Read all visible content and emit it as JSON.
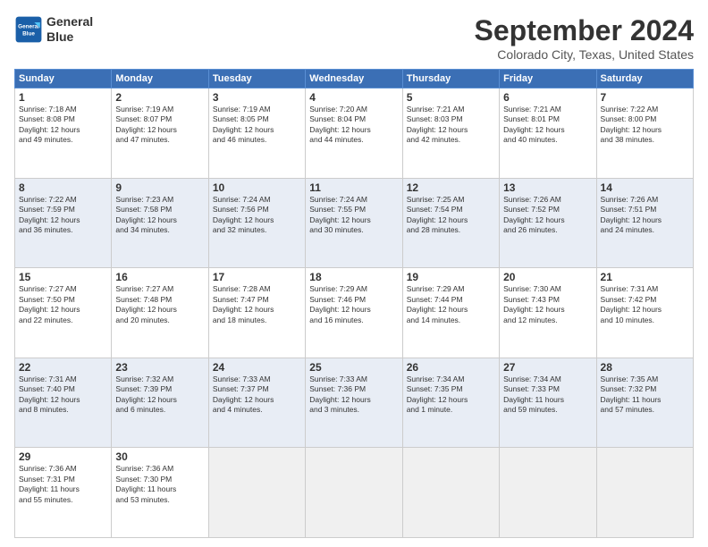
{
  "header": {
    "logo_line1": "General",
    "logo_line2": "Blue",
    "month": "September 2024",
    "location": "Colorado City, Texas, United States"
  },
  "days_of_week": [
    "Sunday",
    "Monday",
    "Tuesday",
    "Wednesday",
    "Thursday",
    "Friday",
    "Saturday"
  ],
  "weeks": [
    [
      {
        "day": "1",
        "lines": [
          "Sunrise: 7:18 AM",
          "Sunset: 8:08 PM",
          "Daylight: 12 hours",
          "and 49 minutes."
        ]
      },
      {
        "day": "2",
        "lines": [
          "Sunrise: 7:19 AM",
          "Sunset: 8:07 PM",
          "Daylight: 12 hours",
          "and 47 minutes."
        ]
      },
      {
        "day": "3",
        "lines": [
          "Sunrise: 7:19 AM",
          "Sunset: 8:05 PM",
          "Daylight: 12 hours",
          "and 46 minutes."
        ]
      },
      {
        "day": "4",
        "lines": [
          "Sunrise: 7:20 AM",
          "Sunset: 8:04 PM",
          "Daylight: 12 hours",
          "and 44 minutes."
        ]
      },
      {
        "day": "5",
        "lines": [
          "Sunrise: 7:21 AM",
          "Sunset: 8:03 PM",
          "Daylight: 12 hours",
          "and 42 minutes."
        ]
      },
      {
        "day": "6",
        "lines": [
          "Sunrise: 7:21 AM",
          "Sunset: 8:01 PM",
          "Daylight: 12 hours",
          "and 40 minutes."
        ]
      },
      {
        "day": "7",
        "lines": [
          "Sunrise: 7:22 AM",
          "Sunset: 8:00 PM",
          "Daylight: 12 hours",
          "and 38 minutes."
        ]
      }
    ],
    [
      {
        "day": "8",
        "lines": [
          "Sunrise: 7:22 AM",
          "Sunset: 7:59 PM",
          "Daylight: 12 hours",
          "and 36 minutes."
        ]
      },
      {
        "day": "9",
        "lines": [
          "Sunrise: 7:23 AM",
          "Sunset: 7:58 PM",
          "Daylight: 12 hours",
          "and 34 minutes."
        ]
      },
      {
        "day": "10",
        "lines": [
          "Sunrise: 7:24 AM",
          "Sunset: 7:56 PM",
          "Daylight: 12 hours",
          "and 32 minutes."
        ]
      },
      {
        "day": "11",
        "lines": [
          "Sunrise: 7:24 AM",
          "Sunset: 7:55 PM",
          "Daylight: 12 hours",
          "and 30 minutes."
        ]
      },
      {
        "day": "12",
        "lines": [
          "Sunrise: 7:25 AM",
          "Sunset: 7:54 PM",
          "Daylight: 12 hours",
          "and 28 minutes."
        ]
      },
      {
        "day": "13",
        "lines": [
          "Sunrise: 7:26 AM",
          "Sunset: 7:52 PM",
          "Daylight: 12 hours",
          "and 26 minutes."
        ]
      },
      {
        "day": "14",
        "lines": [
          "Sunrise: 7:26 AM",
          "Sunset: 7:51 PM",
          "Daylight: 12 hours",
          "and 24 minutes."
        ]
      }
    ],
    [
      {
        "day": "15",
        "lines": [
          "Sunrise: 7:27 AM",
          "Sunset: 7:50 PM",
          "Daylight: 12 hours",
          "and 22 minutes."
        ]
      },
      {
        "day": "16",
        "lines": [
          "Sunrise: 7:27 AM",
          "Sunset: 7:48 PM",
          "Daylight: 12 hours",
          "and 20 minutes."
        ]
      },
      {
        "day": "17",
        "lines": [
          "Sunrise: 7:28 AM",
          "Sunset: 7:47 PM",
          "Daylight: 12 hours",
          "and 18 minutes."
        ]
      },
      {
        "day": "18",
        "lines": [
          "Sunrise: 7:29 AM",
          "Sunset: 7:46 PM",
          "Daylight: 12 hours",
          "and 16 minutes."
        ]
      },
      {
        "day": "19",
        "lines": [
          "Sunrise: 7:29 AM",
          "Sunset: 7:44 PM",
          "Daylight: 12 hours",
          "and 14 minutes."
        ]
      },
      {
        "day": "20",
        "lines": [
          "Sunrise: 7:30 AM",
          "Sunset: 7:43 PM",
          "Daylight: 12 hours",
          "and 12 minutes."
        ]
      },
      {
        "day": "21",
        "lines": [
          "Sunrise: 7:31 AM",
          "Sunset: 7:42 PM",
          "Daylight: 12 hours",
          "and 10 minutes."
        ]
      }
    ],
    [
      {
        "day": "22",
        "lines": [
          "Sunrise: 7:31 AM",
          "Sunset: 7:40 PM",
          "Daylight: 12 hours",
          "and 8 minutes."
        ]
      },
      {
        "day": "23",
        "lines": [
          "Sunrise: 7:32 AM",
          "Sunset: 7:39 PM",
          "Daylight: 12 hours",
          "and 6 minutes."
        ]
      },
      {
        "day": "24",
        "lines": [
          "Sunrise: 7:33 AM",
          "Sunset: 7:37 PM",
          "Daylight: 12 hours",
          "and 4 minutes."
        ]
      },
      {
        "day": "25",
        "lines": [
          "Sunrise: 7:33 AM",
          "Sunset: 7:36 PM",
          "Daylight: 12 hours",
          "and 3 minutes."
        ]
      },
      {
        "day": "26",
        "lines": [
          "Sunrise: 7:34 AM",
          "Sunset: 7:35 PM",
          "Daylight: 12 hours",
          "and 1 minute."
        ]
      },
      {
        "day": "27",
        "lines": [
          "Sunrise: 7:34 AM",
          "Sunset: 7:33 PM",
          "Daylight: 11 hours",
          "and 59 minutes."
        ]
      },
      {
        "day": "28",
        "lines": [
          "Sunrise: 7:35 AM",
          "Sunset: 7:32 PM",
          "Daylight: 11 hours",
          "and 57 minutes."
        ]
      }
    ],
    [
      {
        "day": "29",
        "lines": [
          "Sunrise: 7:36 AM",
          "Sunset: 7:31 PM",
          "Daylight: 11 hours",
          "and 55 minutes."
        ]
      },
      {
        "day": "30",
        "lines": [
          "Sunrise: 7:36 AM",
          "Sunset: 7:30 PM",
          "Daylight: 11 hours",
          "and 53 minutes."
        ]
      },
      {
        "day": "",
        "lines": []
      },
      {
        "day": "",
        "lines": []
      },
      {
        "day": "",
        "lines": []
      },
      {
        "day": "",
        "lines": []
      },
      {
        "day": "",
        "lines": []
      }
    ]
  ]
}
